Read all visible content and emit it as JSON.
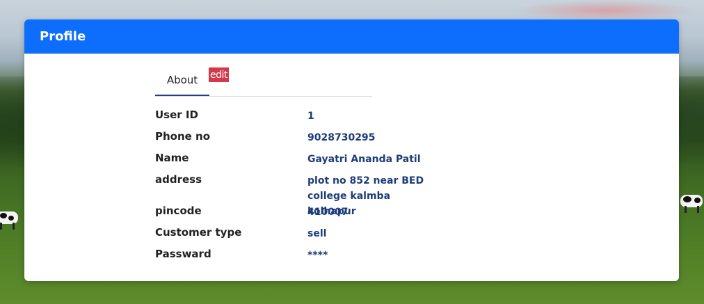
{
  "profile": {
    "title": "Profile",
    "tabs": {
      "about_label": "About",
      "edit_label": "edit"
    },
    "fields": [
      {
        "label": "User ID",
        "value": "1"
      },
      {
        "label": "Phone no",
        "value": "9028730295"
      },
      {
        "label": "Name",
        "value": "Gayatri Ananda Patil"
      },
      {
        "label": "address",
        "value": "plot no 852 near BED college kalmba kolhapur"
      },
      {
        "label": "pincode",
        "value": "410007"
      },
      {
        "label": "Customer type",
        "value": "sell"
      },
      {
        "label": "Passward",
        "value": "****"
      }
    ]
  },
  "colors": {
    "header_blue": "#0d6efd",
    "edit_badge": "#d23a4b",
    "value_text": "#1c3d7a"
  }
}
